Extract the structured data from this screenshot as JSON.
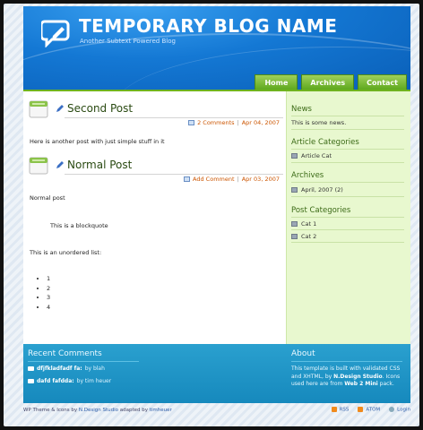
{
  "header": {
    "title": "TEMPORARY BLOG NAME",
    "subtitle": "Another Subtext Powered Blog"
  },
  "nav": [
    {
      "label": "Home"
    },
    {
      "label": "Archives"
    },
    {
      "label": "Contact"
    }
  ],
  "posts": [
    {
      "title": "Second Post",
      "meta_link": "2 Comments",
      "date": "Apr 04, 2007",
      "body": "Here is another post with just simple stuff in it"
    },
    {
      "title": "Normal Post",
      "meta_link": "Add Comment",
      "date": "Apr 03, 2007",
      "body_lines": [
        "Normal post",
        "This is a blockquote",
        "This is an unordered list:"
      ],
      "list": [
        "1",
        "2",
        "3",
        "4"
      ]
    }
  ],
  "sidebar": {
    "news_heading": "News",
    "news_text": "This is some news.",
    "article_cats_heading": "Article Categories",
    "article_cats": [
      "Article Cat"
    ],
    "archives_heading": "Archives",
    "archives": [
      "April, 2007 (2)"
    ],
    "post_cats_heading": "Post Categories",
    "post_cats": [
      "Cat 1",
      "Cat 2"
    ]
  },
  "footer": {
    "recent_heading": "Recent Comments",
    "comments": [
      {
        "text": "dfjfkladfadf fa:",
        "by": "by blah"
      },
      {
        "text": "dafd fafdda:",
        "by": "by tim heuer"
      }
    ],
    "about_heading": "About",
    "about_text_1": "This template is built with validated CSS and XHTML, by ",
    "about_strong_1": "N.Design Studio",
    "about_text_2": ". Icons used here are from ",
    "about_strong_2": "Web 2 Mini",
    "about_text_3": " pack."
  },
  "bottom": {
    "credit_1": "WP Theme & Icons",
    "credit_2": " by ",
    "credit_3": "N.Design Studio",
    "credit_4": " adapted by ",
    "credit_5": "timheuer",
    "rss": "RSS",
    "atom": "ATOM",
    "login": "Login"
  },
  "colors": {
    "header_blue": "#1478d4",
    "nav_green": "#6fb31f",
    "sidebar_bg": "#e8f8cf",
    "footer_blue": "#1e94c6",
    "link_orange": "#cc5500"
  },
  "icons": {
    "logo": "chat-pencil-icon",
    "post_type": "pencil-icon",
    "comments": "comment-bubble-icon",
    "category": "folder-icon",
    "rss": "rss-icon",
    "atom": "atom-icon",
    "login": "login-icon"
  }
}
